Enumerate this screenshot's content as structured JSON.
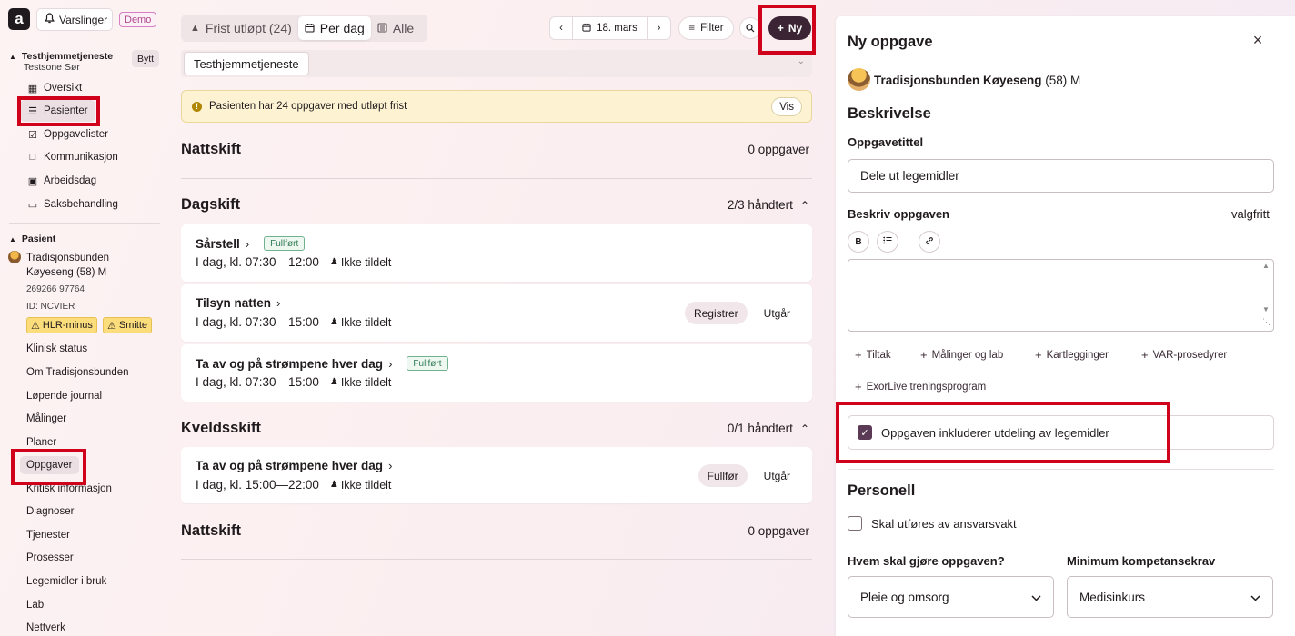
{
  "sidebar": {
    "brand": "a",
    "notifications_label": "Varslinger",
    "demo_badge": "Demo",
    "unit": {
      "name": "Testhjemmetjeneste",
      "sub": "Testsone Sør",
      "switch_label": "Bytt"
    },
    "nav": [
      {
        "label": "Oversikt",
        "icon": "grid-icon"
      },
      {
        "label": "Pasienter",
        "icon": "patients-icon"
      },
      {
        "label": "Oppgavelister",
        "icon": "checklist-icon"
      },
      {
        "label": "Kommunikasjon",
        "icon": "message-icon"
      },
      {
        "label": "Arbeidsdag",
        "icon": "briefcase-icon"
      },
      {
        "label": "Saksbehandling",
        "icon": "folder-icon"
      }
    ],
    "patient_section": "Pasient",
    "patient": {
      "name_line1": "Tradisjonsbunden",
      "name_line2": "Køyeseng (58) M",
      "phone": "269266 97764",
      "id": "ID: NCVIER",
      "warnings": [
        "HLR-minus",
        "Smitte"
      ]
    },
    "patient_nav": [
      "Klinisk status",
      "Om Tradisjonsbunden",
      "Løpende journal",
      "Målinger",
      "Planer",
      "Oppgaver",
      "Kritisk informasjon",
      "Diagnoser",
      "Tjenester",
      "Prosesser",
      "Legemidler i bruk",
      "Lab",
      "Nettverk"
    ]
  },
  "main": {
    "tabs": [
      {
        "label": "Frist utløpt (24)",
        "icon": "warning-icon"
      },
      {
        "label": "Per dag",
        "icon": "calendar-icon"
      },
      {
        "label": "Alle",
        "icon": "list-icon"
      }
    ],
    "date_label": "18. mars",
    "filter_label": "Filter",
    "new_label": "Ny",
    "unit_chip": "Testhjemmetjeneste",
    "alert": {
      "text": "Pasienten har 24 oppgaver med utløpt frist",
      "button": "Vis"
    },
    "shifts": [
      {
        "name": "Nattskift",
        "count": "0 oppgaver"
      },
      {
        "name": "Dagskift",
        "count": "2/3 håndtert"
      },
      {
        "name": "Kveldsskift",
        "count": "0/1 håndtert"
      },
      {
        "name": "Nattskift",
        "count": "0 oppgaver"
      }
    ],
    "tasks": [
      {
        "title": "Sårstell",
        "badge": "Fullført",
        "time": "I dag, kl. 07:30—12:00",
        "assignee": "Ikke tildelt"
      },
      {
        "title": "Tilsyn natten",
        "time": "I dag, kl. 07:30—15:00",
        "assignee": "Ikke tildelt",
        "primary": "Registrer",
        "secondary": "Utgår"
      },
      {
        "title": "Ta av og på strømpene hver dag",
        "badge": "Fullført",
        "time": "I dag, kl. 07:30—15:00",
        "assignee": "Ikke tildelt"
      },
      {
        "title": "Ta av og på strømpene hver dag",
        "time": "I dag, kl. 15:00—22:00",
        "assignee": "Ikke tildelt",
        "primary": "Fullfør",
        "secondary": "Utgår"
      }
    ]
  },
  "panel": {
    "title": "Ny oppgave",
    "patient_name": "Tradisjonsbunden Køyeseng",
    "patient_suffix": "(58) M",
    "section_description": "Beskrivelse",
    "task_title_label": "Oppgavetittel",
    "task_title_value": "Dele ut legemidler",
    "describe_label": "Beskriv oppgaven",
    "optional_label": "valgfritt",
    "format_bold": "B",
    "add_links": [
      "Tiltak",
      "Målinger og lab",
      "Kartlegginger",
      "VAR-prosedyrer",
      "ExorLive treningsprogram"
    ],
    "medication_checkbox_label": "Oppgaven inkluderer utdeling av legemidler",
    "section_personnel": "Personell",
    "responsible_checkbox_label": "Skal utføres av ansvarsvakt",
    "who_label": "Hvem skal gjøre oppgaven?",
    "who_value": "Pleie og omsorg",
    "competence_label": "Minimum kompetansekrav",
    "competence_value": "Medisinkurs"
  }
}
